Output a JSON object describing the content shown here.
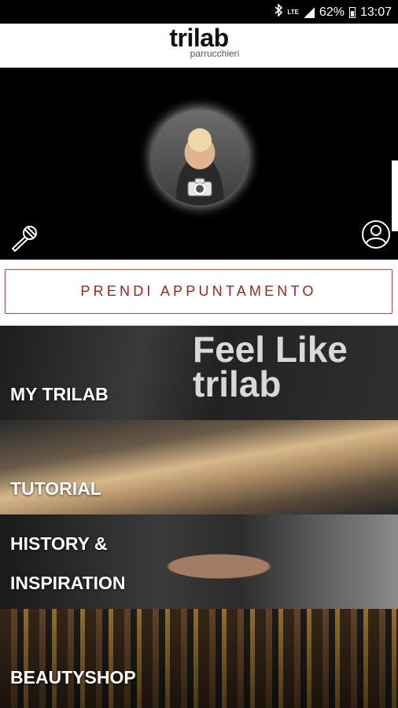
{
  "status_bar": {
    "battery": "62%",
    "time": "13:07",
    "network": "LTE"
  },
  "header": {
    "brand": "trilab",
    "subtitle": "parrucchieri"
  },
  "profile": {
    "camera_icon": "camera-icon",
    "mic_icon": "microphone-icon",
    "user_icon": "user-icon"
  },
  "cta": {
    "label": "PRENDI APPUNTAMENTO",
    "color": "#a42424"
  },
  "tiles": [
    {
      "label": "MY TRILAB",
      "decor": "Feel Like trilab"
    },
    {
      "label": "TUTORIAL"
    },
    {
      "label_line1": "HISTORY &",
      "label_line2": "INSPIRATION"
    },
    {
      "label": "BEAUTYSHOP"
    }
  ]
}
